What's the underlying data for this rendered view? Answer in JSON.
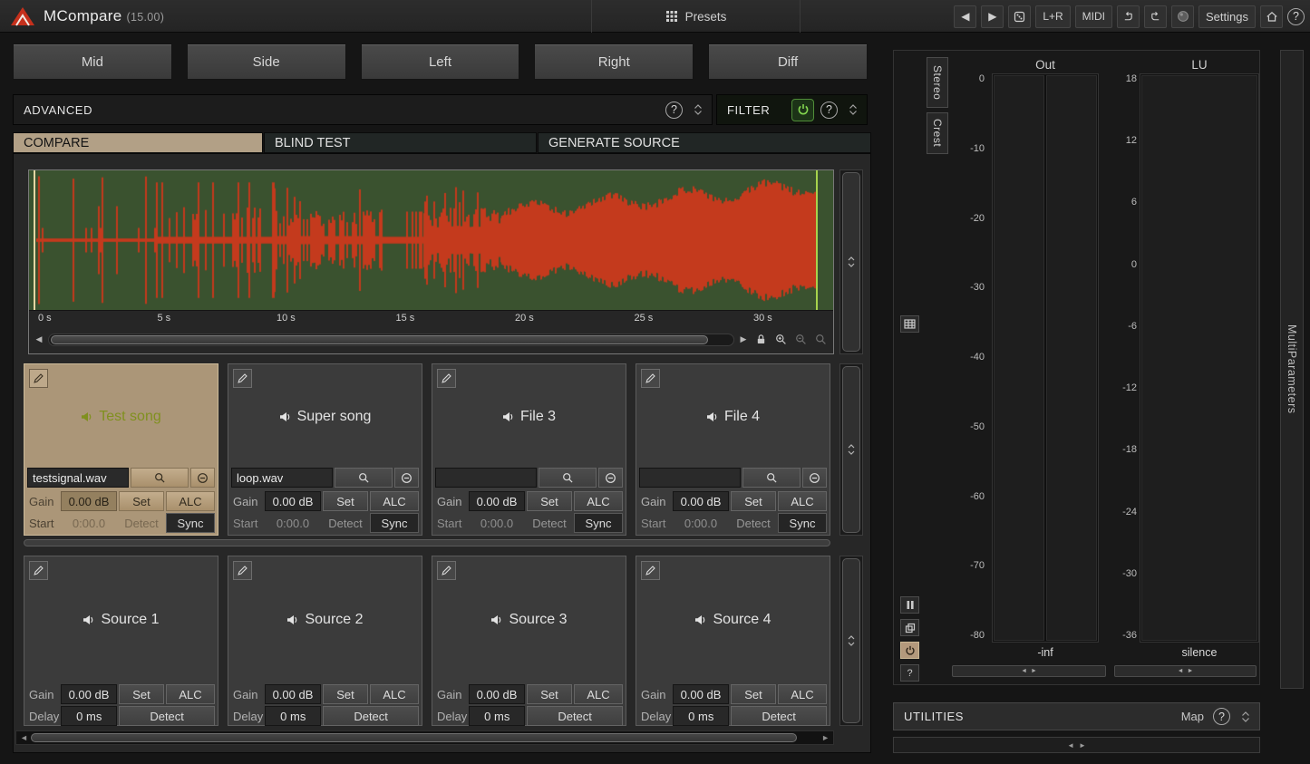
{
  "colors": {
    "accent_tan": "#ab9678",
    "filter_green": "#83d64f",
    "wave_bg": "#3a522f",
    "wave_red": "#c43a1d"
  },
  "glyphs": {
    "help": "?",
    "prev": "◀",
    "next": "▶",
    "left": "◄",
    "right": "►"
  },
  "titlebar": {
    "app_title": "MCompare",
    "version": "(15.00)",
    "presets_label": "Presets",
    "lr_label": "L+R",
    "midi_label": "MIDI",
    "settings_label": "Settings"
  },
  "channel_buttons": [
    "Mid",
    "Side",
    "Left",
    "Right",
    "Diff"
  ],
  "advanced_bar": {
    "label": "ADVANCED"
  },
  "filter_bar": {
    "label": "FILTER"
  },
  "tabs": {
    "compare": "COMPARE",
    "blind": "BLIND TEST",
    "generate": "GENERATE SOURCE"
  },
  "waveform": {
    "time_labels": [
      "0 s",
      "5 s",
      "10 s",
      "15 s",
      "20 s",
      "25 s",
      "30 s"
    ]
  },
  "file_labels": {
    "gain": "Gain",
    "set": "Set",
    "alc": "ALC",
    "start": "Start",
    "detect": "Detect",
    "sync": "Sync"
  },
  "files": [
    {
      "name": "Test song",
      "filename": "testsignal.wav",
      "gain": "0.00 dB",
      "start": "0:00.0"
    },
    {
      "name": "Super song",
      "filename": "loop.wav",
      "gain": "0.00 dB",
      "start": "0:00.0"
    },
    {
      "name": "File 3",
      "filename": "",
      "gain": "0.00 dB",
      "start": "0:00.0"
    },
    {
      "name": "File 4",
      "filename": "",
      "gain": "0.00 dB",
      "start": "0:00.0"
    }
  ],
  "source_labels": {
    "gain": "Gain",
    "set": "Set",
    "alc": "ALC",
    "delay": "Delay",
    "detect": "Detect"
  },
  "sources": [
    {
      "name": "Source 1",
      "gain": "0.00 dB",
      "delay": "0 ms"
    },
    {
      "name": "Source 2",
      "gain": "0.00 dB",
      "delay": "0 ms"
    },
    {
      "name": "Source 3",
      "gain": "0.00 dB",
      "delay": "0 ms"
    },
    {
      "name": "Source 4",
      "gain": "0.00 dB",
      "delay": "0 ms"
    }
  ],
  "meters": {
    "stereo_label": "Stereo",
    "crest_label": "Crest",
    "out": {
      "title": "Out",
      "ticks": [
        "0",
        "-10",
        "-20",
        "-30",
        "-40",
        "-50",
        "-60",
        "-70",
        "-80"
      ],
      "floor_label": "-inf"
    },
    "lu": {
      "title": "LU",
      "ticks": [
        "18",
        "12",
        "6",
        "0",
        "-6",
        "-12",
        "-18",
        "-24",
        "-30",
        "-36"
      ],
      "floor_label": "silence"
    }
  },
  "right_rail": {
    "multiparameters_label": "MultiParameters"
  },
  "utilities": {
    "title": "UTILITIES",
    "map_label": "Map"
  }
}
